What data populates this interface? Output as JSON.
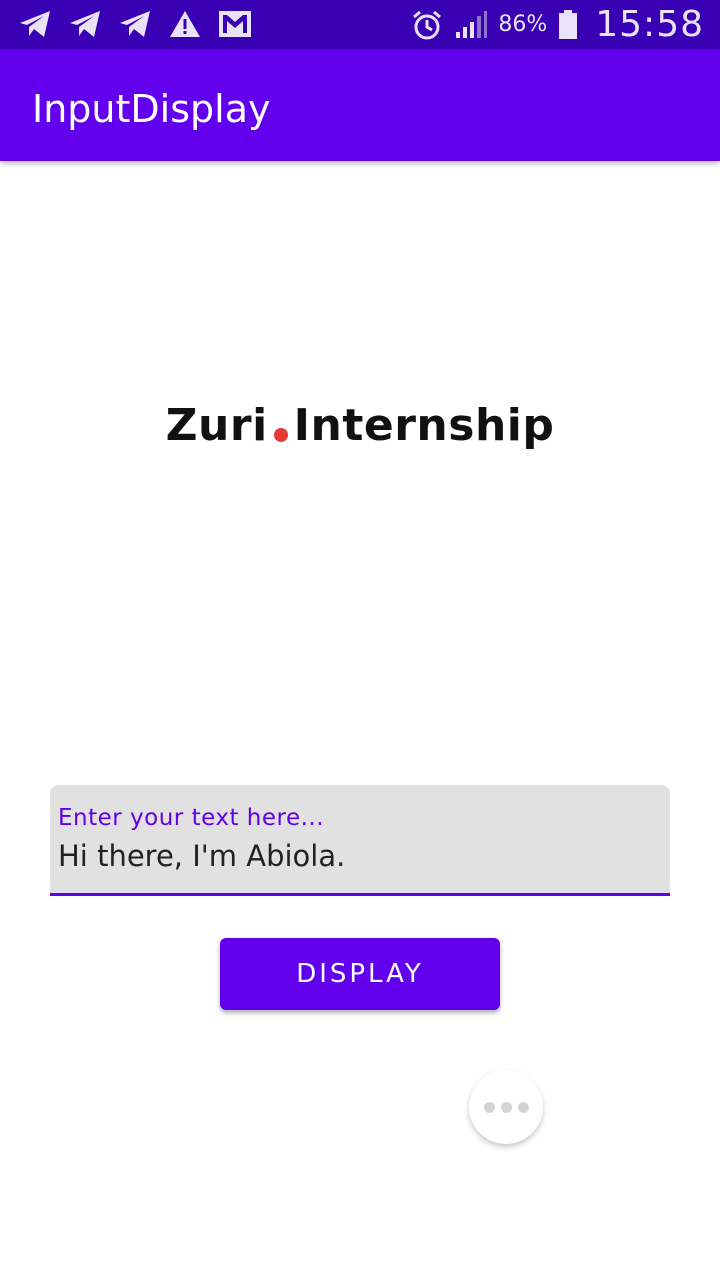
{
  "status_bar": {
    "left_icons": [
      "telegram-icon",
      "telegram-icon",
      "telegram-icon",
      "warning-icon",
      "gmail-icon"
    ],
    "right_icons": [
      "alarm-icon",
      "signal-icon",
      "battery-icon"
    ],
    "battery_percent": "86%",
    "time": "15:58"
  },
  "app_bar": {
    "title": "InputDisplay",
    "color": "#6200ee"
  },
  "logo": {
    "part1": "Zuri",
    "part2": "Internship",
    "dot_color": "#e53935"
  },
  "input": {
    "label": "Enter your text here...",
    "value": "Hi there, I'm Abiola."
  },
  "button": {
    "label": "DISPLAY"
  },
  "floating_menu": {
    "icon": "more-dots-icon"
  }
}
